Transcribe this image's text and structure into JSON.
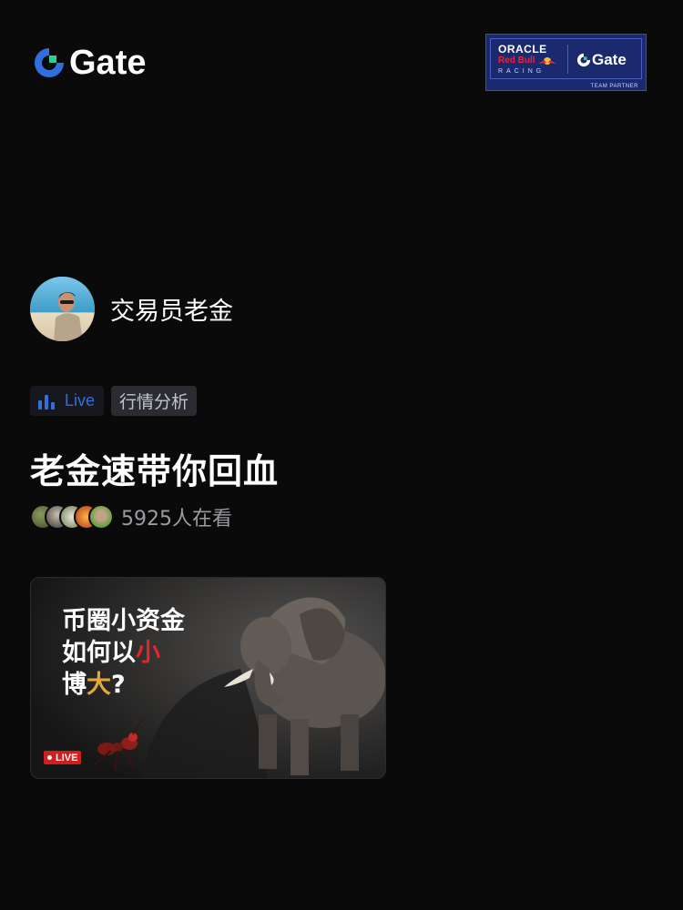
{
  "brand": {
    "name": "Gate",
    "icon": "gate-logo-icon"
  },
  "partner_badge": {
    "line1": "ORACLE",
    "line2": "Red Bull",
    "line3": "RACING",
    "brand": "Gate",
    "footer": "TEAM PARTNER"
  },
  "host": {
    "name": "交易员老金"
  },
  "tags": {
    "live_label": "Live",
    "category": "行情分析"
  },
  "stream": {
    "title": "老金速带你回血",
    "viewer_count": "5925人在看"
  },
  "thumbnail": {
    "line1": "币圈小资金",
    "line2_a": "如何以",
    "line2_b": "小",
    "line3_a": "博",
    "line3_b": "大",
    "line3_c": "?",
    "badge": "LIVE"
  },
  "colors": {
    "accent_blue": "#2f6fe0",
    "live_red": "#d11d1d",
    "background": "#0a0a0a"
  }
}
